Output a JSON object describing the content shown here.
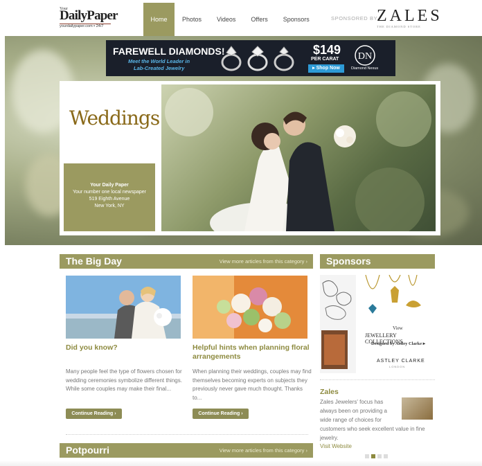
{
  "header": {
    "logo_your": "Your",
    "logo_name": "DailyPaper",
    "logo_url": "yourdailypaper.com ▪ 24/7",
    "nav": [
      "Home",
      "Photos",
      "Videos",
      "Offers",
      "Sponsors"
    ],
    "sponsored_label": "SPONSORED BY",
    "sponsor_logo": "ZALES",
    "sponsor_tagline": "THE DIAMOND STORE"
  },
  "ad": {
    "title": "FAREWELL DIAMONDS!",
    "line1": "Meet the World Leader in",
    "line2": "Lab-Created Jewelry",
    "price": "$149",
    "per_carat": "PER CARAT",
    "cta": "▸ Shop Now",
    "brand": "Diamond Nexus",
    "brand_mark": "DN"
  },
  "hero": {
    "title": "Weddings",
    "info_title": "Your Daily Paper",
    "info_line1": "Your number one local newspaper",
    "info_line2": "519 Eighth Avenue",
    "info_line3": "New York, NY"
  },
  "big_day": {
    "title": "The Big Day",
    "more": "View more articles from this category ›",
    "articles": [
      {
        "title": "Did you know?",
        "body": "Many people feel the type of flowers chosen for wedding ceremonies symbolize different things. While some couples may make their final...",
        "button": "Continue Reading ›"
      },
      {
        "title": "Helpful hints when planning floral arrangements",
        "body": "When planning their weddings, couples may find themselves becoming experts on subjects they previously never gave much thought. Thanks to...",
        "button": "Continue Reading ›"
      }
    ]
  },
  "sponsors": {
    "title": "Sponsors",
    "ad_view": "View",
    "ad_line1": "JEWELLERY COLLECTIONS",
    "ad_line2": "Designed by Astley Clarke ▸",
    "ad_brand": "ASTLEY CLARKE",
    "ad_brand_sub": "LONDON",
    "name": "Zales",
    "body1": "Zales Jewelers' focus has always been on providing a wide range of choices for",
    "body2": "customers who seek excellent value in fine jewelry.",
    "link": "Visit Website"
  },
  "potpourri": {
    "title": "Potpourri",
    "more": "View more articles from this category ›"
  },
  "colors": {
    "accent": "#9b9a60",
    "accent_text": "#8d8a3f"
  }
}
